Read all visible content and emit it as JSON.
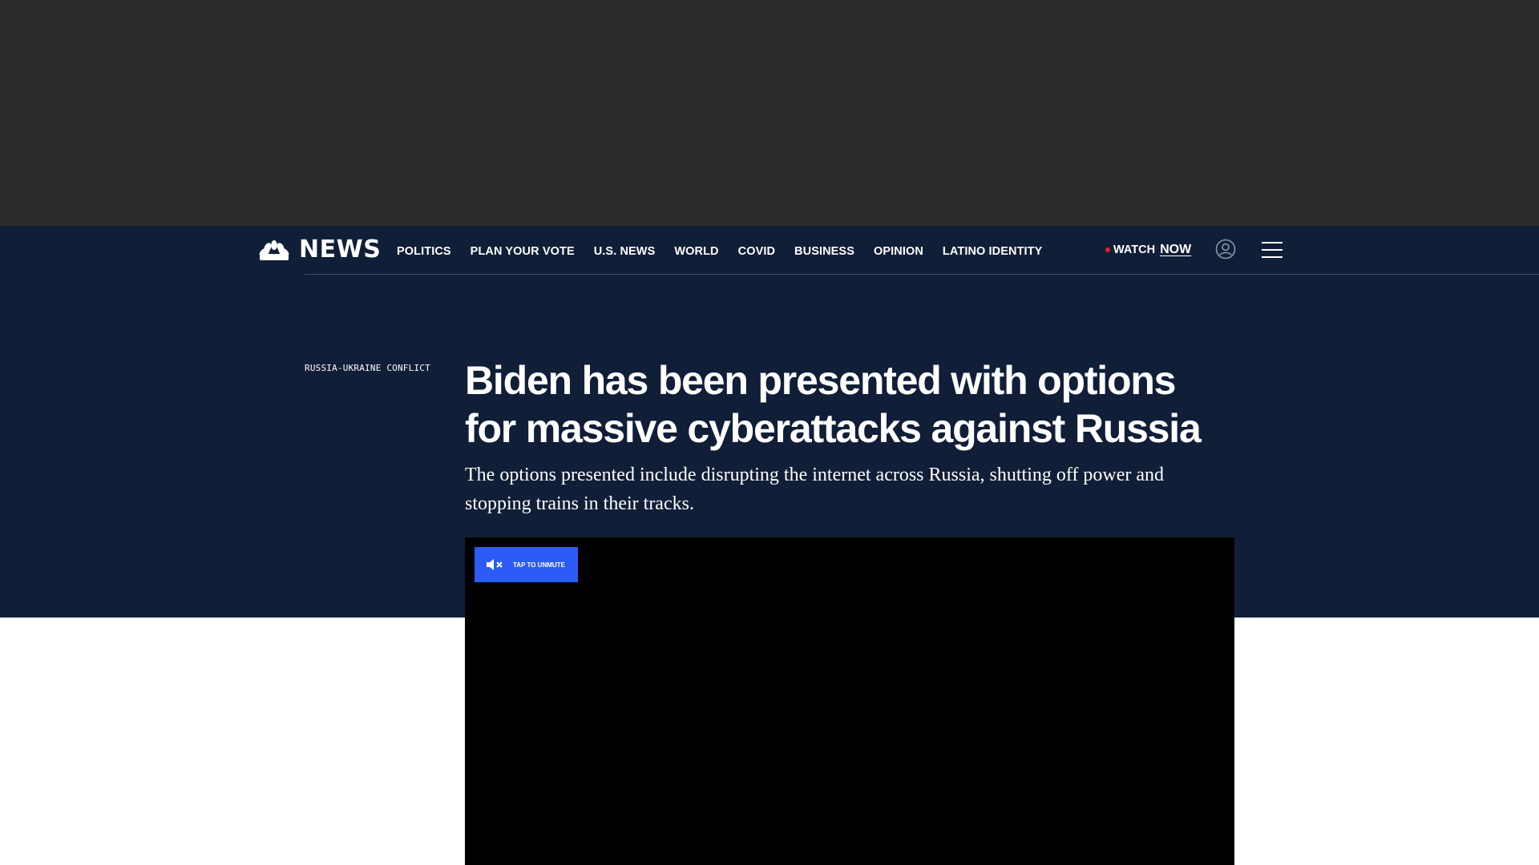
{
  "site": {
    "logo_text": "NEWS",
    "colors": {
      "header_bg": "#111e37",
      "ad_bg": "#2b2b2b",
      "accent_blue": "#2c5cf5",
      "live_red": "#d9262a"
    }
  },
  "nav": {
    "links": [
      "POLITICS",
      "PLAN YOUR VOTE",
      "U.S. NEWS",
      "WORLD",
      "COVID",
      "BUSINESS",
      "OPINION",
      "LATINO IDENTITY"
    ],
    "watch_label": "WATCH",
    "now_label": "NOW",
    "icons": {
      "logo": "peacock-icon",
      "user": "user-icon",
      "menu": "menu-icon"
    }
  },
  "article": {
    "eyebrow": "RUSSIA-UKRAINE CONFLICT",
    "headline": "Biden has been presented with options for massive cyberattacks against Russia",
    "dek": "The options presented include disrupting the internet across Russia, shutting off power and stopping trains in their tracks."
  },
  "video": {
    "unmute_label": "TAP TO UNMUTE",
    "icon": "speaker-muted-icon"
  }
}
